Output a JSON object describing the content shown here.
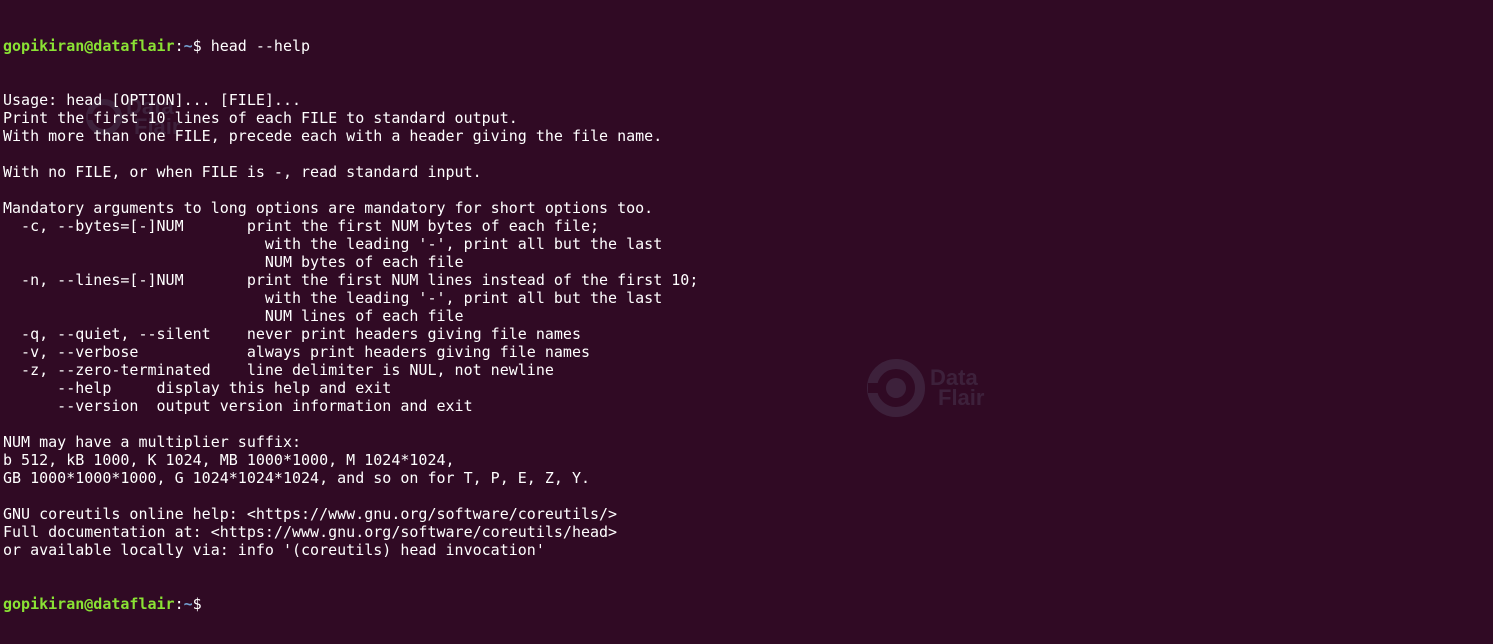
{
  "prompt": {
    "user_host": "gopikiran@dataflair",
    "separator": ":",
    "path": "~",
    "symbol": "$ "
  },
  "command": "head --help",
  "output_lines": [
    "Usage: head [OPTION]... [FILE]...",
    "Print the first 10 lines of each FILE to standard output.",
    "With more than one FILE, precede each with a header giving the file name.",
    "",
    "With no FILE, or when FILE is -, read standard input.",
    "",
    "Mandatory arguments to long options are mandatory for short options too.",
    "  -c, --bytes=[-]NUM       print the first NUM bytes of each file;",
    "                             with the leading '-', print all but the last",
    "                             NUM bytes of each file",
    "  -n, --lines=[-]NUM       print the first NUM lines instead of the first 10;",
    "                             with the leading '-', print all but the last",
    "                             NUM lines of each file",
    "  -q, --quiet, --silent    never print headers giving file names",
    "  -v, --verbose            always print headers giving file names",
    "  -z, --zero-terminated    line delimiter is NUL, not newline",
    "      --help     display this help and exit",
    "      --version  output version information and exit",
    "",
    "NUM may have a multiplier suffix:",
    "b 512, kB 1000, K 1024, MB 1000*1000, M 1024*1024,",
    "GB 1000*1000*1000, G 1024*1024*1024, and so on for T, P, E, Z, Y.",
    "",
    "GNU coreutils online help: <https://www.gnu.org/software/coreutils/>",
    "Full documentation at: <https://www.gnu.org/software/coreutils/head>",
    "or available locally via: info '(coreutils) head invocation'"
  ],
  "watermark": {
    "line1": "Data",
    "line2": "Flair"
  },
  "colors": {
    "background": "#300a24",
    "text": "#ffffff",
    "user_host": "#8ae234",
    "path": "#729fcf"
  }
}
